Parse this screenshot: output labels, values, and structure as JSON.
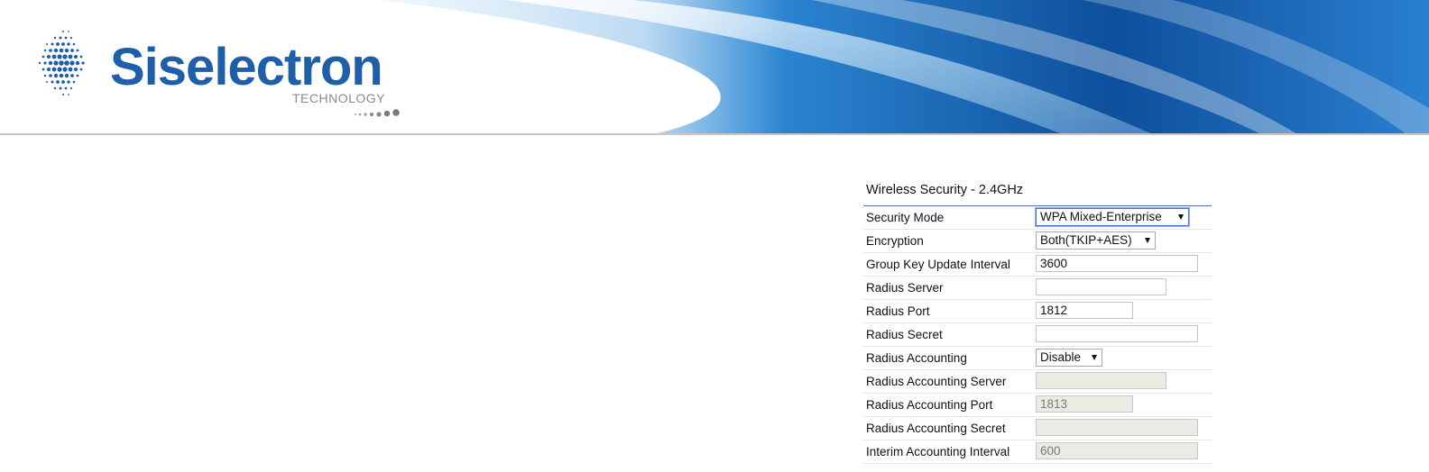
{
  "header": {
    "brand_name": "Siselectron",
    "brand_subtitle": "TECHNOLOGY"
  },
  "panel": {
    "title": "Wireless Security - 2.4GHz",
    "rows": [
      {
        "label": "Security Mode",
        "kind": "select",
        "value": "WPA Mixed-Enterprise"
      },
      {
        "label": "Encryption",
        "kind": "select",
        "value": "Both(TKIP+AES)"
      },
      {
        "label": "Group Key Update Interval",
        "kind": "input",
        "value": ""
      },
      {
        "label": "Radius Server",
        "kind": "input",
        "value": ""
      },
      {
        "label": "Radius Port",
        "kind": "input",
        "value": "1812"
      },
      {
        "label": "Radius Secret",
        "kind": "input",
        "value": ""
      },
      {
        "label": "Radius Accounting",
        "kind": "select",
        "value": "Disable"
      },
      {
        "label": "Radius Accounting Server",
        "kind": "input-disabled",
        "value": ""
      },
      {
        "label": "Radius Accounting Port",
        "kind": "input-disabled",
        "value": "1813"
      },
      {
        "label": "Radius Accounting Secret",
        "kind": "input-disabled",
        "value": ""
      },
      {
        "label": "Interim Accounting Interval",
        "kind": "input-disabled",
        "value": "600"
      }
    ],
    "group_key_value": "3600"
  },
  "colors": {
    "brand_blue": "#1f5ea8",
    "banner_blue": "#1e73c8",
    "title_rule": "#5a6fb3",
    "disabled_bg": "#ebebe4"
  }
}
